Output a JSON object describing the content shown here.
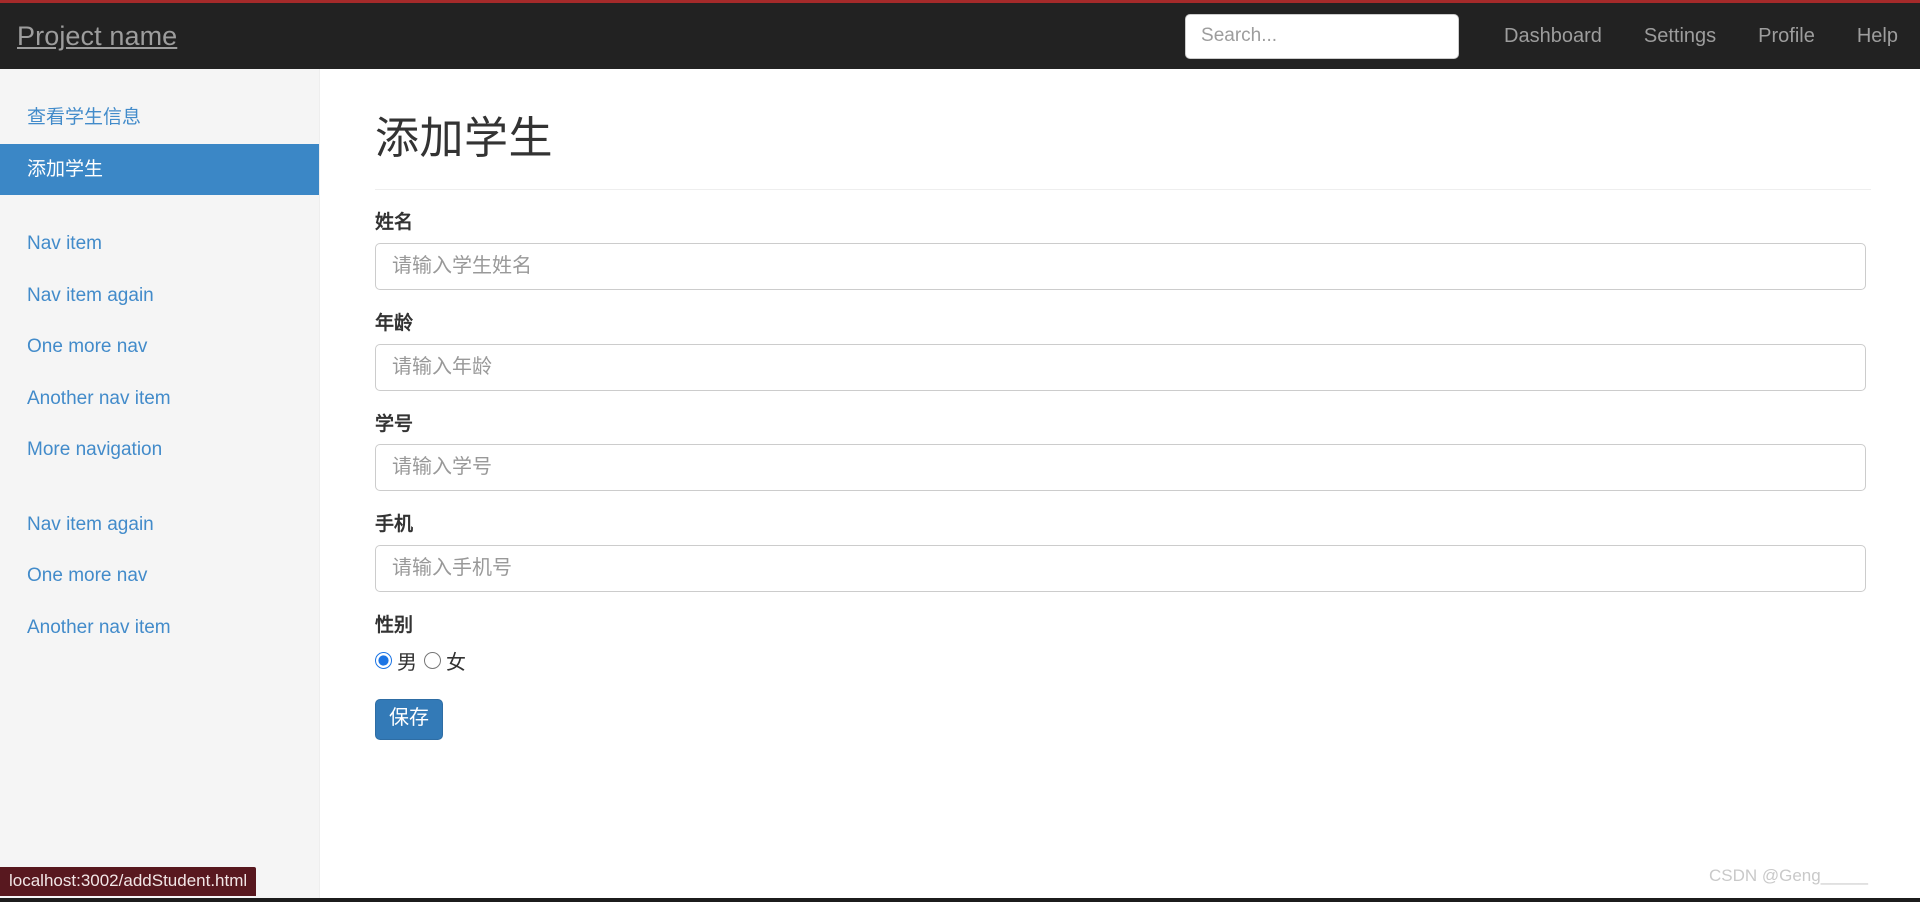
{
  "navbar": {
    "brand": "Project name",
    "search": {
      "placeholder": "Search...",
      "value": ""
    },
    "links": [
      {
        "label": "Dashboard"
      },
      {
        "label": "Settings"
      },
      {
        "label": "Profile"
      },
      {
        "label": "Help"
      }
    ]
  },
  "sidebar": {
    "group1": [
      {
        "label": "查看学生信息",
        "active": false
      },
      {
        "label": "添加学生",
        "active": true
      }
    ],
    "group2": [
      {
        "label": "Nav item"
      },
      {
        "label": "Nav item again"
      },
      {
        "label": "One more nav"
      },
      {
        "label": "Another nav item"
      },
      {
        "label": "More navigation"
      }
    ],
    "group3": [
      {
        "label": "Nav item again"
      },
      {
        "label": "One more nav"
      },
      {
        "label": "Another nav item"
      }
    ]
  },
  "main": {
    "title": "添加学生",
    "fields": [
      {
        "label": "姓名",
        "placeholder": "请输入学生姓名",
        "value": ""
      },
      {
        "label": "年龄",
        "placeholder": "请输入年龄",
        "value": ""
      },
      {
        "label": "学号",
        "placeholder": "请输入学号",
        "value": ""
      },
      {
        "label": "手机",
        "placeholder": "请输入手机号",
        "value": ""
      }
    ],
    "gender": {
      "label": "性别",
      "options": [
        {
          "label": "男",
          "checked": true
        },
        {
          "label": "女",
          "checked": false
        }
      ]
    },
    "save_label": "保存"
  },
  "status_bar": {
    "url": "localhost:3002/addStudent.html"
  },
  "watermark": {
    "text": "CSDN @Geng_____"
  },
  "colors": {
    "navbar_bg": "#222222",
    "sidebar_bg": "#f5f5f5",
    "active_item_bg": "#3b87c6",
    "link_blue": "#428bca",
    "button_blue": "#337ab7",
    "status_bar_bg": "#58181f"
  }
}
